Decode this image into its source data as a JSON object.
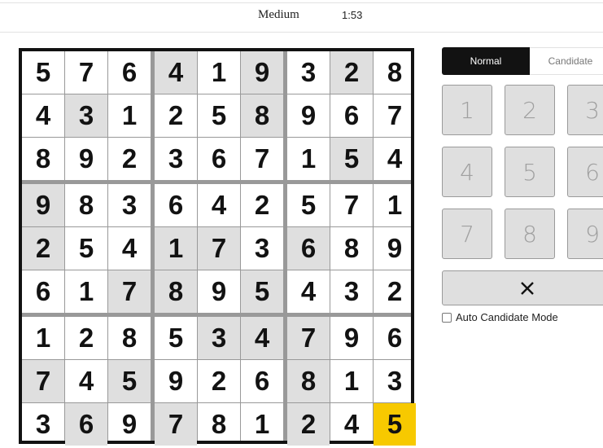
{
  "header": {
    "difficulty": "Medium",
    "timer": "1:53"
  },
  "board": {
    "cells": [
      [
        5,
        7,
        6,
        4,
        1,
        9,
        3,
        2,
        8
      ],
      [
        4,
        3,
        1,
        2,
        5,
        8,
        9,
        6,
        7
      ],
      [
        8,
        9,
        2,
        3,
        6,
        7,
        1,
        5,
        4
      ],
      [
        9,
        8,
        3,
        6,
        4,
        2,
        5,
        7,
        1
      ],
      [
        2,
        5,
        4,
        1,
        7,
        3,
        6,
        8,
        9
      ],
      [
        6,
        1,
        7,
        8,
        9,
        5,
        4,
        3,
        2
      ],
      [
        1,
        2,
        8,
        5,
        3,
        4,
        7,
        9,
        6
      ],
      [
        7,
        4,
        5,
        9,
        2,
        6,
        8,
        1,
        3
      ],
      [
        3,
        6,
        9,
        7,
        8,
        1,
        2,
        4,
        5
      ]
    ],
    "given": [
      [
        0,
        0,
        0,
        1,
        0,
        1,
        0,
        1,
        0
      ],
      [
        0,
        1,
        0,
        0,
        0,
        1,
        0,
        0,
        0
      ],
      [
        0,
        0,
        0,
        0,
        0,
        0,
        0,
        1,
        0
      ],
      [
        1,
        0,
        0,
        0,
        0,
        0,
        0,
        0,
        0
      ],
      [
        1,
        0,
        0,
        1,
        1,
        0,
        1,
        0,
        0
      ],
      [
        0,
        0,
        1,
        1,
        0,
        1,
        0,
        0,
        0
      ],
      [
        0,
        0,
        0,
        0,
        1,
        1,
        1,
        0,
        0
      ],
      [
        1,
        0,
        1,
        0,
        0,
        0,
        1,
        0,
        0
      ],
      [
        0,
        1,
        0,
        1,
        0,
        0,
        1,
        0,
        0
      ]
    ],
    "selected": {
      "row": 8,
      "col": 8
    },
    "colors": {
      "given_bg": "#dfdfdf",
      "selected_bg": "#f7c900",
      "text": "#121212"
    }
  },
  "mode_tabs": {
    "normal_label": "Normal",
    "candidate_label": "Candidate",
    "active": "Normal"
  },
  "keypad": {
    "keys": [
      "1",
      "2",
      "3",
      "4",
      "5",
      "6",
      "7",
      "8",
      "9"
    ],
    "erase_icon": "close-icon",
    "erase_glyph": "✕"
  },
  "auto_candidate": {
    "label": "Auto Candidate Mode",
    "checked": false
  }
}
